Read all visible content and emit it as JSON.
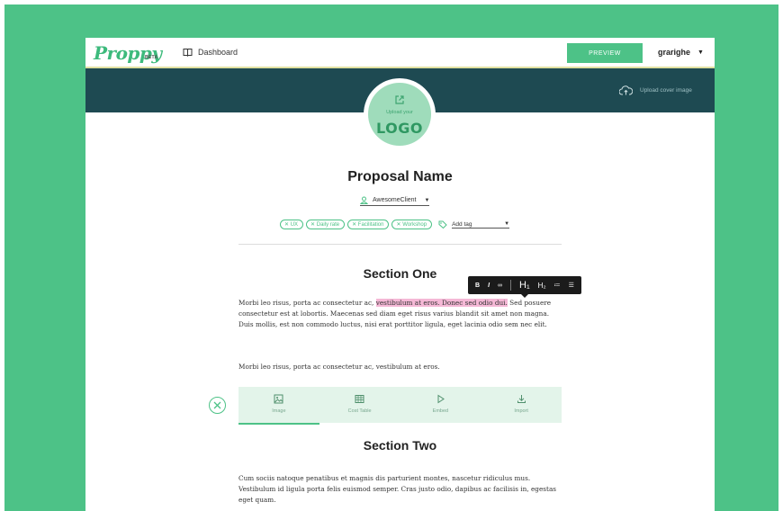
{
  "app": {
    "logo_text": "Proppy",
    "beta_label": "BETA"
  },
  "topbar": {
    "dashboard_label": "Dashboard",
    "preview_label": "PREVIEW",
    "username": "grarighe"
  },
  "banner": {
    "upload_cover_label": "Upload cover image"
  },
  "logo_placeholder": {
    "upload_text": "Upload your",
    "logo_text": "LOGO"
  },
  "proposal": {
    "name": "Proposal Name",
    "client": "AwesomeClient",
    "tags": [
      "UX",
      "Daily rate",
      "Facilitation",
      "Workshop"
    ],
    "add_tag_label": "Add tag"
  },
  "format_toolbar": {
    "bold": "B",
    "italic": "I",
    "link": "∞",
    "h1": "H₁",
    "h2": "H₂",
    "ordered_list": "≔",
    "bullet_list": "☰"
  },
  "section_one": {
    "title": "Section One",
    "para1_before": "Morbi leo risus, porta ac consectetur ac, ",
    "para1_highlight": "vestibulum at eros. Donec sed odio dui.",
    "para1_after": " Sed posuere consectetur est at lobortis. Maecenas sed diam eget risus varius blandit sit amet non magna. Duis mollis, est non commodo luctus, nisi erat porttitor ligula, eget lacinia odio sem nec elit.",
    "para2": "Morbi leo risus, porta ac consectetur ac, vestibulum at eros."
  },
  "insert_bar": {
    "items": [
      "Image",
      "Cost Table",
      "Embed",
      "Import"
    ],
    "active_index": 0
  },
  "section_two": {
    "title": "Section Two",
    "para1": "Cum sociis natoque penatibus et magnis dis parturient montes, nascetur ridiculus mus. Vestibulum id ligula porta felis euismod semper. Cras justo odio, dapibus ac facilisis in, egestas eget quam."
  },
  "colors": {
    "brand_green": "#4dc287",
    "banner_dark": "#1e4a52",
    "highlight_pink": "#f5b8d6"
  }
}
